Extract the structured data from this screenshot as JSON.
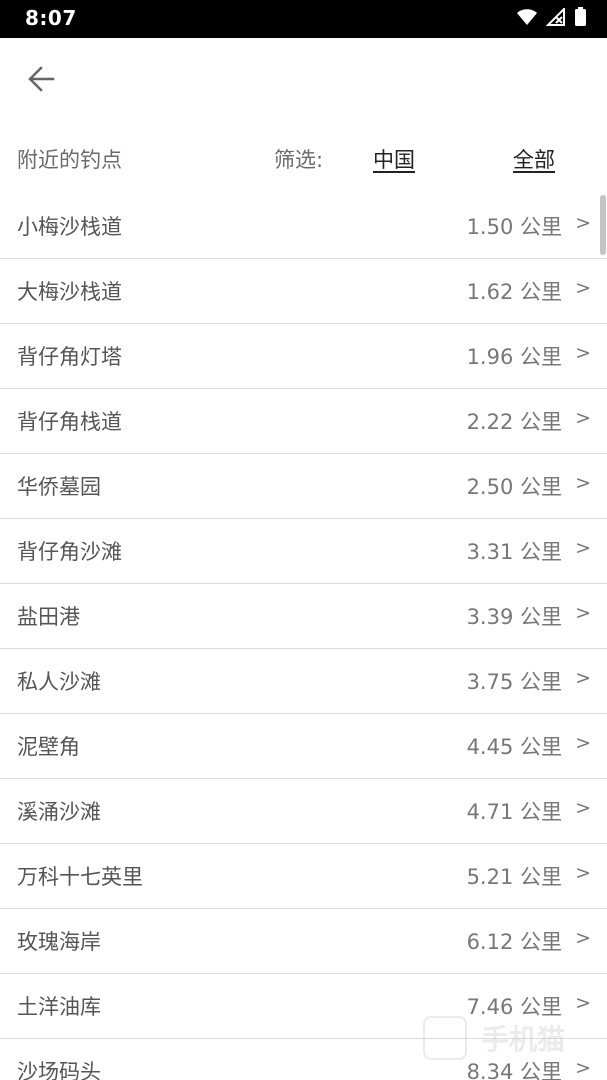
{
  "status_bar": {
    "time": "8:07",
    "icons": [
      "wifi-icon",
      "signal-icon",
      "battery-icon"
    ]
  },
  "header": {
    "back_icon": "arrow-left-icon"
  },
  "filter": {
    "title": "附近的钓点",
    "label": "筛选:",
    "options": [
      "中国",
      "全部"
    ]
  },
  "spots": [
    {
      "name": "小梅沙栈道",
      "distance": "1.50 公里",
      "chevron": ">"
    },
    {
      "name": "大梅沙栈道",
      "distance": "1.62 公里",
      "chevron": ">"
    },
    {
      "name": "背仔角灯塔",
      "distance": "1.96 公里",
      "chevron": ">"
    },
    {
      "name": "背仔角栈道",
      "distance": "2.22 公里",
      "chevron": ">"
    },
    {
      "name": "华侨墓园",
      "distance": "2.50 公里",
      "chevron": ">"
    },
    {
      "name": "背仔角沙滩",
      "distance": "3.31 公里",
      "chevron": ">"
    },
    {
      "name": "盐田港",
      "distance": "3.39 公里",
      "chevron": ">"
    },
    {
      "name": "私人沙滩",
      "distance": "3.75 公里",
      "chevron": ">"
    },
    {
      "name": "泥壁角",
      "distance": "4.45 公里",
      "chevron": ">"
    },
    {
      "name": "溪涌沙滩",
      "distance": "4.71 公里",
      "chevron": ">"
    },
    {
      "name": "万科十七英里",
      "distance": "5.21 公里",
      "chevron": ">"
    },
    {
      "name": "玫瑰海岸",
      "distance": "6.12 公里",
      "chevron": ">"
    },
    {
      "name": "土洋油库",
      "distance": "7.46 公里",
      "chevron": ">"
    },
    {
      "name": "沙场码头",
      "distance": "8.34 公里",
      "chevron": ">"
    }
  ],
  "watermark": {
    "text": "手机猫"
  },
  "colors": {
    "status_bar": "#000000",
    "background": "#ffffff",
    "divider": "#dcdcdc",
    "text": "#555555"
  }
}
